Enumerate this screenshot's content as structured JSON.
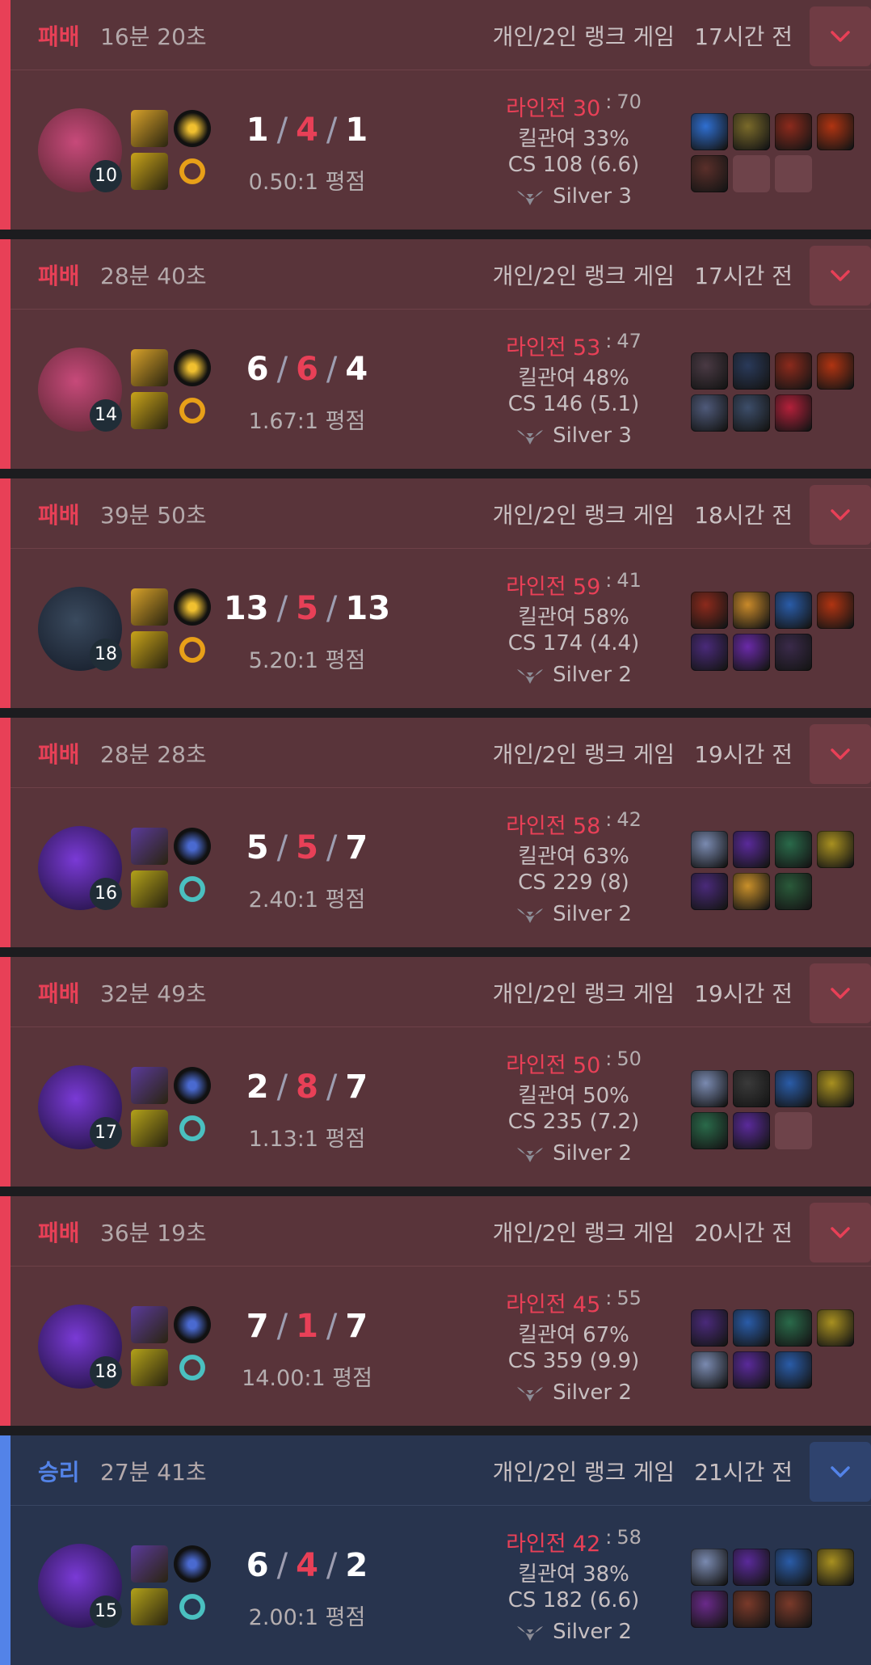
{
  "games": [
    {
      "result": "패배",
      "outcome": "loss",
      "duration": "16분 20초",
      "queue": "개인/2인 랭크 게임",
      "ago": "17시간 전",
      "champion": "Vi",
      "level": "10",
      "spells": [
        "flash",
        "smite"
      ],
      "runes": [
        "conqueror",
        "precision"
      ],
      "kills": "1",
      "deaths": "4",
      "assists": "1",
      "kda_ratio": "0.50:1 평점",
      "lane_label": "라인전",
      "lane_win": "30",
      "lane_colon": ":",
      "lane_lose": "70",
      "kill_participation": "킬관여 33%",
      "cs": "CS 108 (6.6)",
      "tier": "Silver 3",
      "items": [
        "blue-orb",
        "blade",
        "bag",
        "red-tower",
        "boots",
        "empty",
        "empty"
      ],
      "colors": {
        "champ": [
          "#c74a7a",
          "#6a2b3c"
        ],
        "items": [
          "#2f6fd1",
          "#7a6a2a",
          "#8c2a1c",
          "#b03412",
          "#5a2f2a"
        ]
      }
    },
    {
      "result": "패배",
      "outcome": "loss",
      "duration": "28분 40초",
      "queue": "개인/2인 랭크 게임",
      "ago": "17시간 전",
      "champion": "Vi",
      "level": "14",
      "spells": [
        "flash",
        "smite"
      ],
      "runes": [
        "conqueror",
        "precision"
      ],
      "kills": "6",
      "deaths": "6",
      "assists": "4",
      "kda_ratio": "1.67:1 평점",
      "lane_label": "라인전",
      "lane_win": "53",
      "lane_colon": ":",
      "lane_lose": "47",
      "kill_participation": "킬관여 48%",
      "cs": "CS 146 (5.1)",
      "tier": "Silver 3",
      "items": [
        "dark-armor",
        "spear",
        "bag",
        "red-tower",
        "blade",
        "knife",
        "red-gem"
      ],
      "colors": {
        "champ": [
          "#c74a7a",
          "#6a2b3c"
        ],
        "items": [
          "#4a3a44",
          "#2a3a5a",
          "#8c2a1c",
          "#b03412",
          "#4f5a7a",
          "#3d4e6a",
          "#b3203a"
        ]
      }
    },
    {
      "result": "패배",
      "outcome": "loss",
      "duration": "39분 50초",
      "queue": "개인/2인 랭크 게임",
      "ago": "18시간 전",
      "champion": "Viego",
      "level": "18",
      "spells": [
        "flash",
        "smite"
      ],
      "runes": [
        "conqueror",
        "precision"
      ],
      "kills": "13",
      "deaths": "5",
      "assists": "13",
      "kda_ratio": "5.20:1 평점",
      "lane_label": "라인전",
      "lane_win": "59",
      "lane_colon": ":",
      "lane_lose": "41",
      "kill_participation": "킬관여 58%",
      "cs": "CS 174 (4.4)",
      "tier": "Silver 2",
      "items": [
        "bag",
        "gauntlet",
        "gold-blue",
        "red-tower",
        "purple-hat",
        "purple-staff",
        "dark-hat"
      ],
      "colors": {
        "champ": [
          "#3a4a5e",
          "#1a2230"
        ],
        "items": [
          "#8c2a1c",
          "#c98a2a",
          "#2a5ca8",
          "#b03412",
          "#4a2a7a",
          "#6a2aa8",
          "#3a2a4a"
        ]
      }
    },
    {
      "result": "패배",
      "outcome": "loss",
      "duration": "28분 28초",
      "queue": "개인/2인 랭크 게임",
      "ago": "19시간 전",
      "champion": "Kassadin",
      "level": "16",
      "spells": [
        "ghost",
        "ignite"
      ],
      "runes": [
        "dark-harvest",
        "domination"
      ],
      "kills": "5",
      "deaths": "5",
      "assists": "7",
      "kda_ratio": "2.40:1 평점",
      "lane_label": "라인전",
      "lane_win": "58",
      "lane_colon": ":",
      "lane_lose": "42",
      "kill_participation": "킬관여 63%",
      "cs": "CS 229 (8)",
      "tier": "Silver 2",
      "items": [
        "lich",
        "purple-wing",
        "green-boots",
        "gold-orb",
        "purple-hat",
        "hammer",
        "green-orb"
      ],
      "colors": {
        "champ": [
          "#7a3ad6",
          "#2a1650"
        ],
        "items": [
          "#7a8ab0",
          "#5a2a9a",
          "#2a6a4a",
          "#a89020",
          "#4a2a7a",
          "#c9902a",
          "#2a5a3a"
        ]
      }
    },
    {
      "result": "패배",
      "outcome": "loss",
      "duration": "32분 49초",
      "queue": "개인/2인 랭크 게임",
      "ago": "19시간 전",
      "champion": "Kassadin",
      "level": "17",
      "spells": [
        "ghost",
        "ignite"
      ],
      "runes": [
        "dark-harvest",
        "domination"
      ],
      "kills": "2",
      "deaths": "8",
      "assists": "7",
      "kda_ratio": "1.13:1 평점",
      "lane_label": "라인전",
      "lane_win": "50",
      "lane_colon": ":",
      "lane_lose": "50",
      "kill_participation": "킬관여 50%",
      "cs": "CS 235 (7.2)",
      "tier": "Silver 2",
      "items": [
        "lich",
        "dark-mask",
        "blue-staff",
        "gold-orb",
        "green-boots",
        "purple-wing",
        "empty"
      ],
      "colors": {
        "champ": [
          "#7a3ad6",
          "#2a1650"
        ],
        "items": [
          "#7a8ab0",
          "#3a3a3a",
          "#2a5ca8",
          "#a89020",
          "#2a6a4a",
          "#5a2a9a"
        ]
      }
    },
    {
      "result": "패배",
      "outcome": "loss",
      "duration": "36분 19초",
      "queue": "개인/2인 랭크 게임",
      "ago": "20시간 전",
      "champion": "Kassadin",
      "level": "18",
      "spells": [
        "ghost",
        "ignite"
      ],
      "runes": [
        "dark-harvest",
        "domination"
      ],
      "kills": "7",
      "deaths": "1",
      "assists": "7",
      "kda_ratio": "14.00:1 평점",
      "lane_label": "라인전",
      "lane_win": "45",
      "lane_colon": ":",
      "lane_lose": "55",
      "kill_participation": "킬관여 67%",
      "cs": "CS 359 (9.9)",
      "tier": "Silver 2",
      "items": [
        "purple-hat",
        "gold-blue",
        "green-boots",
        "gold-orb",
        "lich",
        "purple-wing",
        "blue-staff"
      ],
      "colors": {
        "champ": [
          "#7a3ad6",
          "#2a1650"
        ],
        "items": [
          "#4a2a7a",
          "#2a5ca8",
          "#2a6a4a",
          "#a89020",
          "#7a8ab0",
          "#5a2a9a",
          "#2a5ca8"
        ]
      }
    },
    {
      "result": "승리",
      "outcome": "win",
      "duration": "27분 41초",
      "queue": "개인/2인 랭크 게임",
      "ago": "21시간 전",
      "champion": "Kassadin",
      "level": "15",
      "spells": [
        "ghost",
        "ignite"
      ],
      "runes": [
        "dark-harvest",
        "domination"
      ],
      "kills": "6",
      "deaths": "4",
      "assists": "2",
      "kda_ratio": "2.00:1 평점",
      "lane_label": "라인전",
      "lane_win": "42",
      "lane_colon": ":",
      "lane_lose": "58",
      "kill_participation": "킬관여 38%",
      "cs": "CS 182 (6.6)",
      "tier": "Silver 2",
      "items": [
        "lich",
        "purple-wing",
        "blue-staff",
        "gold-orb",
        "purple-boots",
        "book",
        "book"
      ],
      "colors": {
        "champ": [
          "#7a3ad6",
          "#2a1650"
        ],
        "items": [
          "#7a8ab0",
          "#5a2a9a",
          "#2a5ca8",
          "#a89020",
          "#6a2a8a",
          "#7a3a2a",
          "#7a3a2a"
        ]
      }
    }
  ]
}
